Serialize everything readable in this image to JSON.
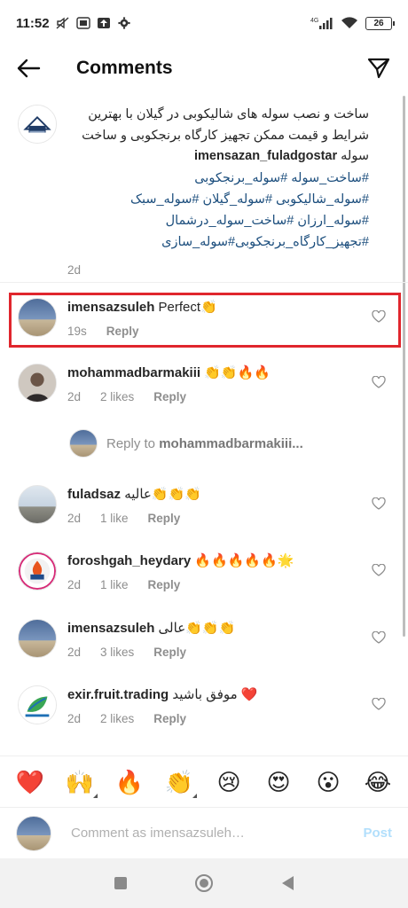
{
  "status_bar": {
    "time": "11:52",
    "battery": "26",
    "network": "4G"
  },
  "header": {
    "title": "Comments"
  },
  "caption": {
    "username": "imensazan_fuladgostar",
    "text": "ساخت و نصب سوله های شالیکوبی در گیلان با بهترین شرایط و قیمت ممکن تجهیز کارگاه برنجکوبی و ساخت سوله",
    "hashtags": [
      "#ساخت_سوله #سوله_برنجکوبی",
      "#سوله_شالیکوبی #سوله_گیلان #سوله_سبک",
      "#سوله_ارزان #ساخت_سوله_درشمال",
      "#تجهیز_کارگاه_برنجکوبی#سوله_سازی"
    ],
    "time": "2d"
  },
  "comments": [
    {
      "username": "imensazsuleh",
      "text": "Perfect👏",
      "time": "19s",
      "likes": "",
      "reply": "Reply"
    },
    {
      "username": "mohammadbarmakiii",
      "text": "👏👏🔥🔥",
      "time": "2d",
      "likes": "2 likes",
      "reply": "Reply"
    },
    {
      "username": "fuladsaz",
      "text": "عالیه👏👏👏",
      "time": "2d",
      "likes": "1 like",
      "reply": "Reply"
    },
    {
      "username": "foroshgah_heydary",
      "text": "🔥🔥🔥🔥🔥🌟",
      "time": "2d",
      "likes": "1 like",
      "reply": "Reply"
    },
    {
      "username": "imensazsuleh",
      "text": "عالی👏👏👏",
      "time": "2d",
      "likes": "3 likes",
      "reply": "Reply"
    },
    {
      "username": "exir.fruit.trading",
      "text": "موفق باشید ❤️",
      "time": "2d",
      "likes": "2 likes",
      "reply": "Reply"
    }
  ],
  "view_reply": {
    "prefix": "Reply to ",
    "username": "mohammadbarmakiii..."
  },
  "emoji_bar": [
    "❤️",
    "🙌",
    "🔥",
    "👏",
    "😢",
    "😍",
    "😮",
    "😂"
  ],
  "comment_input": {
    "placeholder": "Comment as imensazsuleh…",
    "post_label": "Post"
  },
  "colors": {
    "highlight": "#e0262d",
    "hashtag": "#1d4f7e",
    "post_disabled": "#b2dffc"
  }
}
